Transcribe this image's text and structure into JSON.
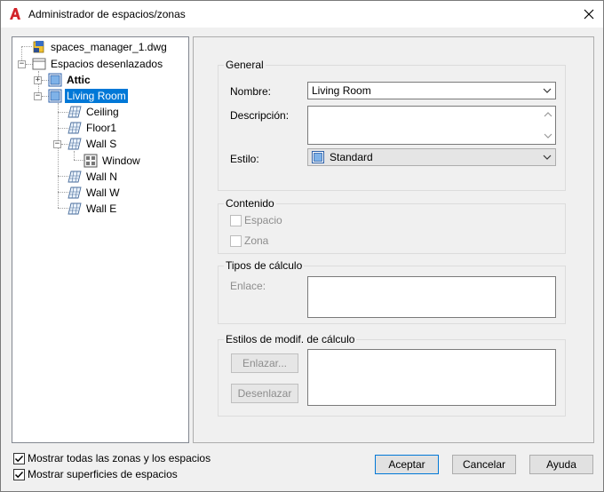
{
  "window": {
    "title": "Administrador de espacios/zonas",
    "close_symbol": "✕"
  },
  "tree": {
    "nodes": [
      {
        "label": "spaces_manager_1.dwg",
        "icon": "drawing-file-icon"
      },
      {
        "label": "Espacios desenlazados",
        "icon": "folder-icon"
      },
      {
        "label": "Attic",
        "icon": "zone-icon"
      },
      {
        "label": "Living Room",
        "icon": "zone-icon"
      },
      {
        "label": "Ceiling",
        "icon": "surface-icon"
      },
      {
        "label": "Floor1",
        "icon": "surface-icon"
      },
      {
        "label": "Wall S",
        "icon": "surface-icon"
      },
      {
        "label": "Window",
        "icon": "opening-icon"
      },
      {
        "label": "Wall N",
        "icon": "surface-icon"
      },
      {
        "label": "Wall W",
        "icon": "surface-icon"
      },
      {
        "label": "Wall E",
        "icon": "surface-icon"
      }
    ]
  },
  "general": {
    "title": "General",
    "name_label": "Nombre:",
    "name_value": "Living Room",
    "description_label": "Descripción:",
    "description_value": "",
    "style_label": "Estilo:",
    "style_value": "Standard"
  },
  "content": {
    "title": "Contenido",
    "space_label": "Espacio",
    "zone_label": "Zona"
  },
  "calc_types": {
    "title": "Tipos de cálculo",
    "link_label": "Enlace:"
  },
  "calc_styles": {
    "title": "Estilos de modif. de cálculo",
    "link_button": "Enlazar...",
    "unlink_button": "Desenlazar"
  },
  "options": {
    "show_all_label": "Mostrar todas las zonas y los espacios",
    "show_surfaces_label": "Mostrar superficies de espacios"
  },
  "buttons": {
    "accept": "Aceptar",
    "cancel": "Cancelar",
    "help": "Ayuda"
  },
  "colors": {
    "selection": "#0078d7",
    "app_icon": "#d2232a"
  }
}
